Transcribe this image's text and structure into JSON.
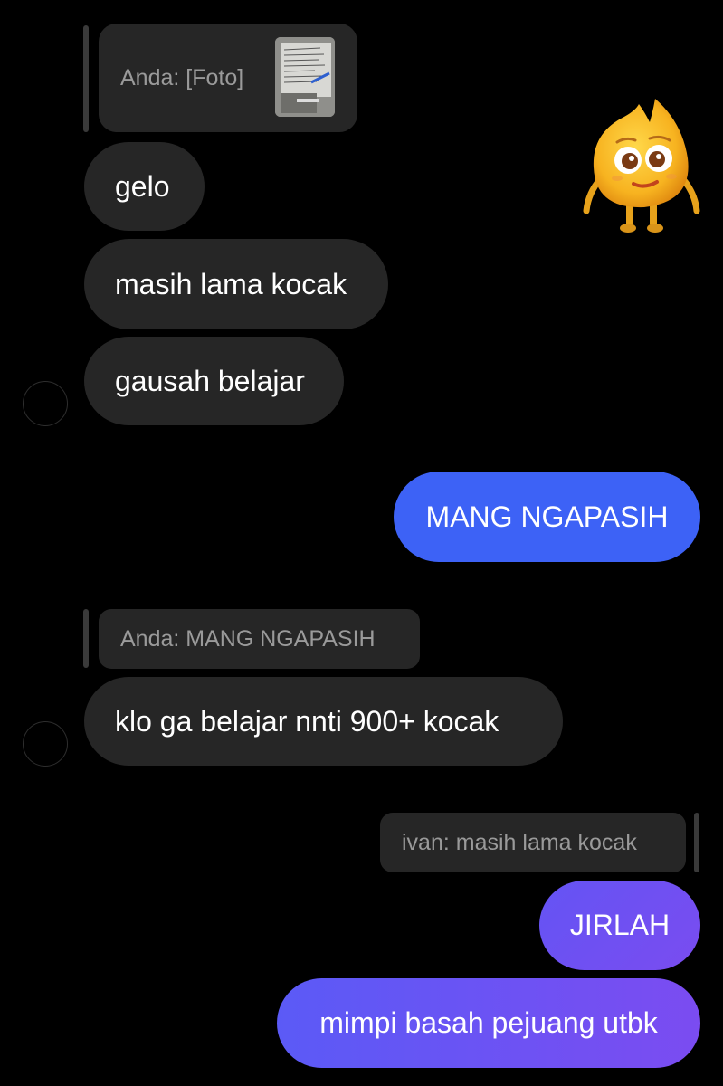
{
  "thread": {
    "reply_photo": {
      "label": "Anda: [Foto]"
    },
    "incoming_1": "gelo",
    "incoming_2": "masih lama kocak",
    "incoming_3": "gausah belajar",
    "outgoing_1": "MANG NGAPASIH",
    "reply_text": "Anda: MANG NGAPASIH",
    "incoming_4": "klo ga belajar nnti 900+ kocak",
    "reply_out": "ivan: masih lama kocak",
    "outgoing_2": "JIRLAH",
    "outgoing_3": "mimpi basah pejuang utbk"
  },
  "colors": {
    "background": "#000000",
    "incoming_bubble": "#262626",
    "outgoing_blue": "#3d62f6",
    "outgoing_purple": "#6b4ff3"
  },
  "icons": {
    "sticker": "yellow-mascot-sticker",
    "photo_thumbnail": "photo-of-paper-thumbnail"
  }
}
